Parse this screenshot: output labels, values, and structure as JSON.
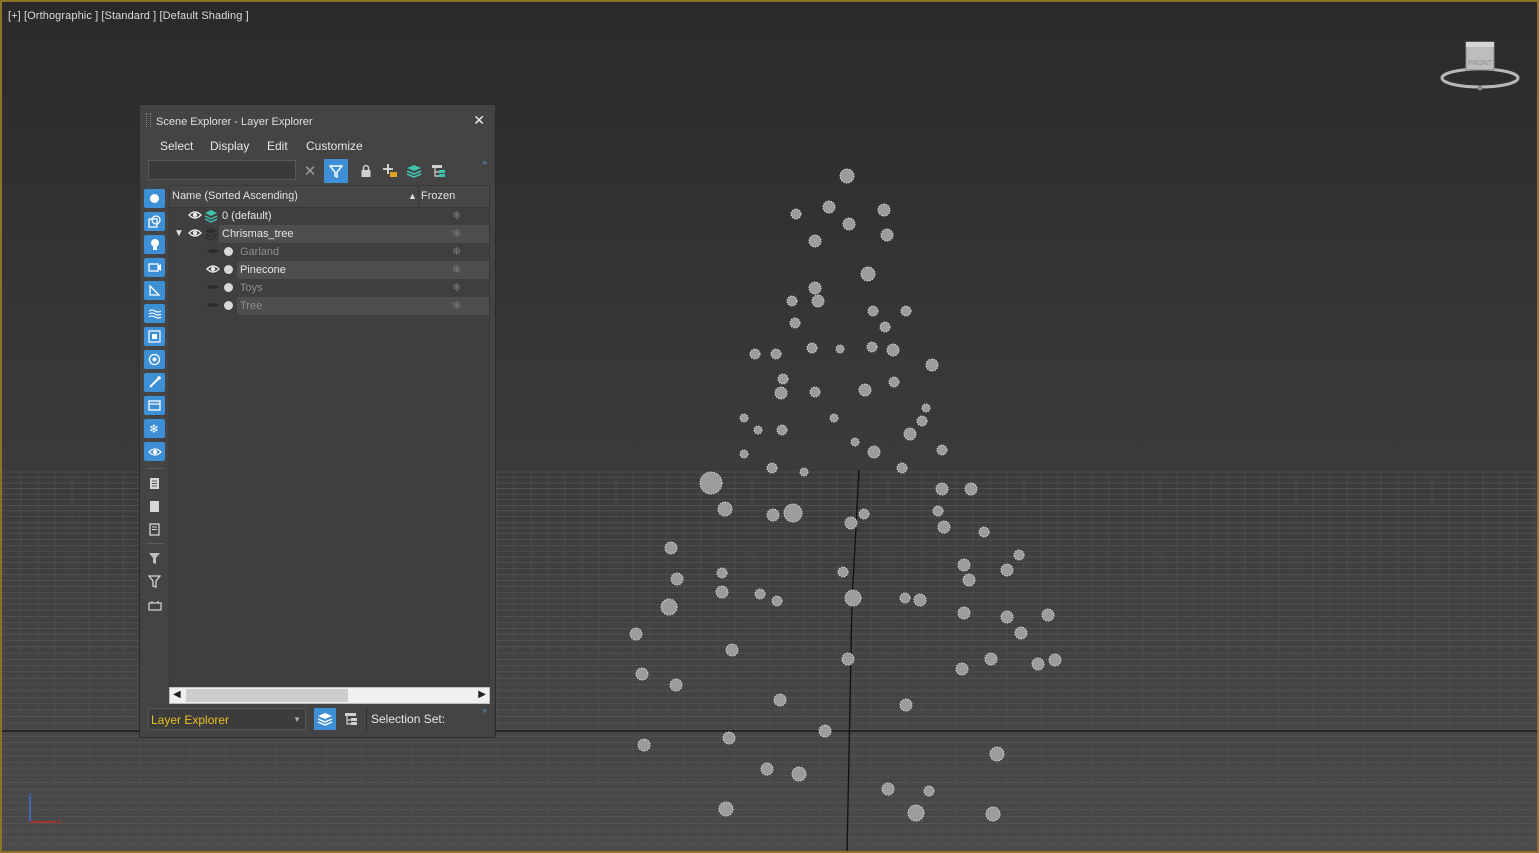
{
  "viewport": {
    "label": "[+] [Orthographic ] [Standard ] [Default Shading ]",
    "viewcube_label": "FRONT"
  },
  "scene_explorer": {
    "title": "Scene Explorer - Layer Explorer",
    "close": "✕",
    "menu": [
      "Select",
      "Display",
      "Edit",
      "Customize"
    ],
    "search": {
      "value": "",
      "placeholder": ""
    },
    "columns": {
      "name": "Name (Sorted Ascending)",
      "sort": "▲",
      "frozen": "Frozen"
    },
    "rows": [
      {
        "name": "0 (default)",
        "level": 0,
        "visible": true,
        "icon": "layer-active-icon",
        "highlight": false
      },
      {
        "name": "Chrismas_tree",
        "level": 0,
        "visible": true,
        "icon": "layer-icon",
        "expanded": true,
        "highlight": true
      },
      {
        "name": "Garland",
        "level": 1,
        "visible": false,
        "icon": "object-dot-icon",
        "highlight": false
      },
      {
        "name": "Pinecone",
        "level": 1,
        "visible": true,
        "icon": "object-dot-icon",
        "highlight": true
      },
      {
        "name": "Toys",
        "level": 1,
        "visible": false,
        "icon": "object-dot-icon",
        "highlight": false
      },
      {
        "name": "Tree",
        "level": 1,
        "visible": false,
        "icon": "object-dot-icon",
        "highlight": true
      }
    ],
    "bottom": {
      "explorer_select": "Layer Explorer",
      "selection_set_label": "Selection Set:"
    }
  },
  "colors": {
    "viewport_border": "#8d7328",
    "accent_blue": "#3d8fd6",
    "explorer_select_text": "#e8c020"
  }
}
